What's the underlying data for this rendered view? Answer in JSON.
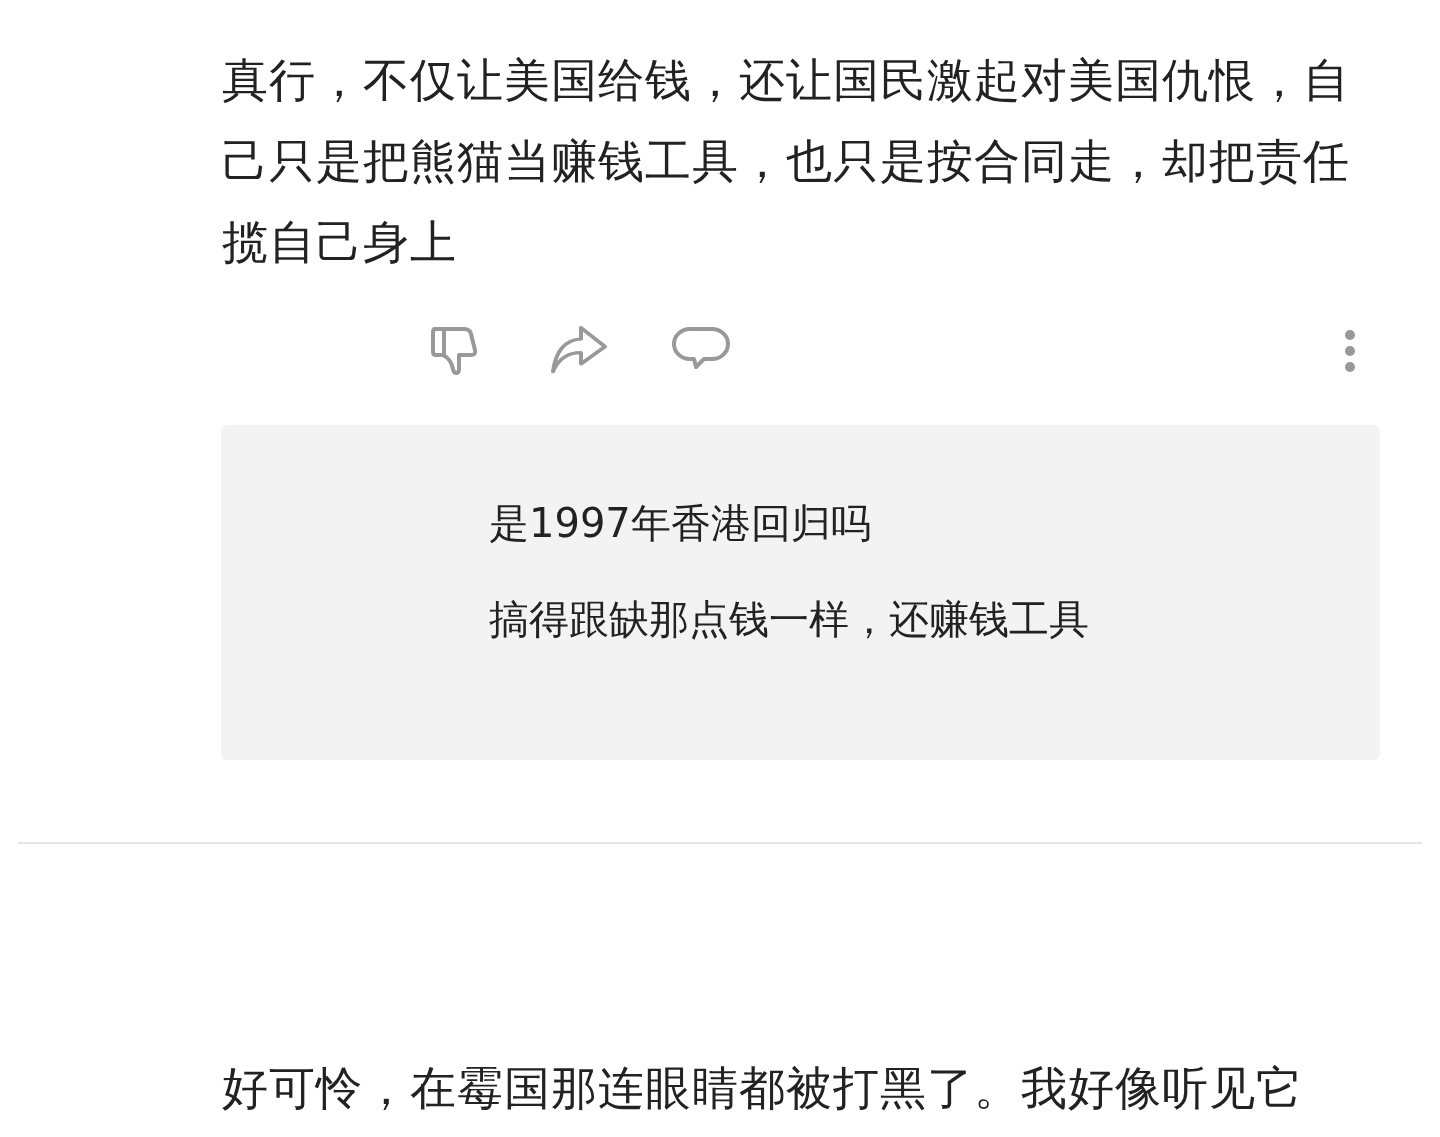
{
  "comment": {
    "text": "真行，不仅让美国给钱，还让国民激起对美国仇恨，自己只是把熊猫当赚钱工具，也只是按合同走，却把责任揽自己身上",
    "replies": [
      {
        "text": "是1997年香港回归吗"
      },
      {
        "text": "搞得跟缺那点钱一样，还赚钱工具"
      }
    ]
  },
  "next_comment": {
    "text": "好可怜，在霉国那连眼睛都被打黑了。我好像听见它"
  }
}
